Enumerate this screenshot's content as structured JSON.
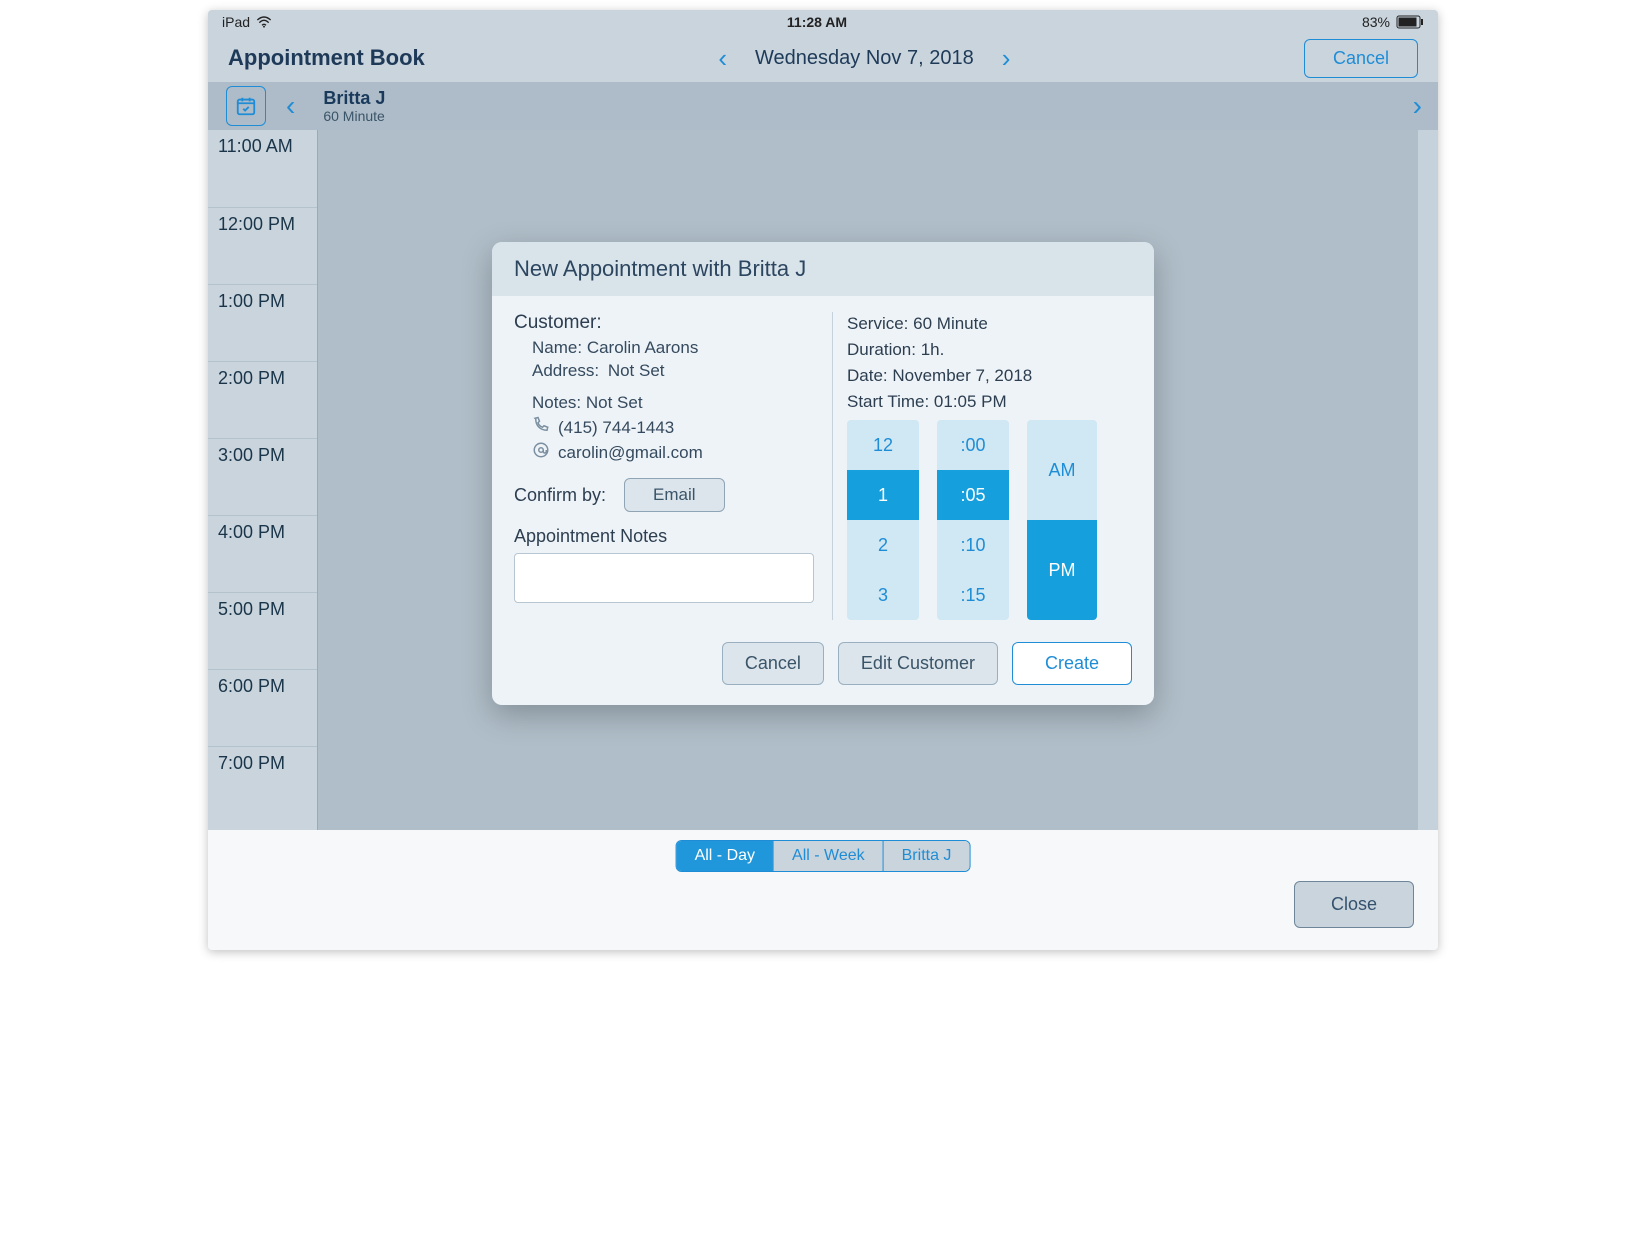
{
  "statusbar": {
    "device": "iPad",
    "time": "11:28 AM",
    "battery": "83%"
  },
  "header": {
    "title": "Appointment Book",
    "date": "Wednesday Nov 7, 2018",
    "cancel_label": "Cancel"
  },
  "staff": {
    "name": "Britta J",
    "service": "60 Minute"
  },
  "time_slots": [
    "11:00 AM",
    "12:00 PM",
    "1:00 PM",
    "2:00 PM",
    "3:00 PM",
    "4:00 PM",
    "5:00 PM",
    "6:00 PM",
    "7:00 PM"
  ],
  "segmented": {
    "all_day": "All - Day",
    "all_week": "All - Week",
    "staff": "Britta J"
  },
  "close_label": "Close",
  "modal": {
    "title": "New Appointment with Britta J",
    "customer_label": "Customer:",
    "name_label": "Name:",
    "name_value": "Carolin Aarons",
    "address_label": "Address:",
    "address_value": "Not Set",
    "notes_label": "Notes:",
    "notes_value": "Not Set",
    "phone": "(415) 744-1443",
    "email": "carolin@gmail.com",
    "confirm_label": "Confirm by:",
    "confirm_btn": "Email",
    "appt_notes_label": "Appointment Notes",
    "appt_notes_value": "",
    "service_label": "Service:",
    "service_value": "60 Minute",
    "duration_label": "Duration:",
    "duration_value": "1h.",
    "date_label": "Date:",
    "date_value": "November 7, 2018",
    "start_label": "Start Time:",
    "start_value": "01:05 PM",
    "picker": {
      "hours": [
        "12",
        "1",
        "2",
        "3"
      ],
      "hour_sel": "1",
      "minutes": [
        ":00",
        ":05",
        ":10",
        ":15"
      ],
      "minute_sel": ":05",
      "ampm": [
        "AM",
        "PM"
      ],
      "ampm_sel": "PM"
    },
    "actions": {
      "cancel": "Cancel",
      "edit": "Edit Customer",
      "create": "Create"
    }
  }
}
